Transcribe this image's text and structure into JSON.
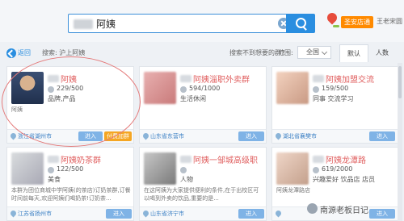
{
  "search": {
    "query": "阿姨"
  },
  "topbar": {
    "vip_label": "圣安店通",
    "user_name": "王老宋圆"
  },
  "filter": {
    "back_label": "返回",
    "search_label": "搜索: 沪上阿姨",
    "hint": "搜索不到想要的群?",
    "range_label": "范围:",
    "range_value": "全国",
    "tabs": [
      "默认",
      "人数"
    ]
  },
  "cards": [
    {
      "name": "阿姨",
      "members": "229/500",
      "tag": "品牌,产品",
      "desc": "阿姨",
      "location": "浙江省湖州市",
      "enter": "进入",
      "pay": "付费加群"
    },
    {
      "name": "阿姨淄职外卖群",
      "members": "594/1000",
      "tag": "生活休闲",
      "desc": "",
      "location": "山东省东营市",
      "enter": "进入"
    },
    {
      "name": "阿姨加盟交流",
      "members": "159/500",
      "tag": "同事  交流学习",
      "desc": "",
      "location": "湖北省襄樊市",
      "enter": "进入"
    },
    {
      "name": "阿姨奶茶群",
      "members": "122/500",
      "tag": "美食",
      "desc": "本群为团位商城中学阿姨(的茶店)订奶茶群,订餐时间前每天,欢迎阿姨们喝奶茶!订奶茶...",
      "location": "江苏省扬州市",
      "enter": "进入"
    },
    {
      "name": "阿姨一邹城高级职",
      "members": "",
      "tag": "人物",
      "desc": "在这阿姨为大家提供便利的条件,在于出校区可以喝到外卖的饮品,重要的是...",
      "location": "山东省济宁市",
      "enter": "进入"
    },
    {
      "name": "阿姨龙潭路",
      "members": "619/2000",
      "tag": "兴趣爱好  饮品店  店员",
      "desc": "阿姨龙潭路店",
      "location": "",
      "enter": "进入"
    }
  ],
  "watermark": "南源老板日记",
  "colors": {
    "accent": "#2a8ee0",
    "highlight": "#e47a7a",
    "name": "#e06060"
  }
}
